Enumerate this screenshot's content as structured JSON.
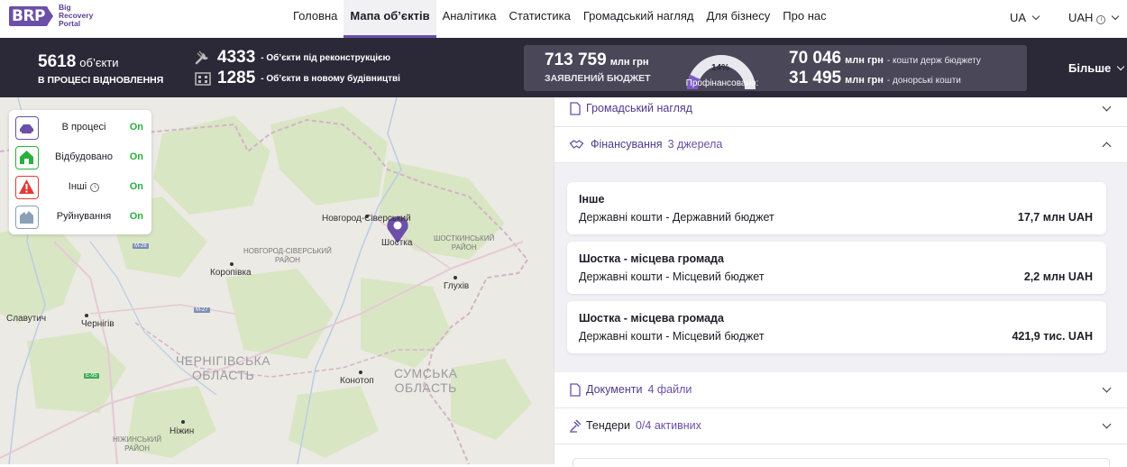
{
  "logo": {
    "mark": "BRP",
    "line1": "Big",
    "line2": "Recovery",
    "line3": "Portal"
  },
  "nav": {
    "links": [
      {
        "label": "Головна",
        "active": false
      },
      {
        "label": "Мапа об’єктів",
        "active": true
      },
      {
        "label": "Аналітика",
        "active": false
      },
      {
        "label": "Статистика",
        "active": false
      },
      {
        "label": "Громадський нагляд",
        "active": false
      },
      {
        "label": "Для бізнесу",
        "active": false
      },
      {
        "label": "Про нас",
        "active": false
      }
    ],
    "language": "UA",
    "currency": "UAH"
  },
  "stats": {
    "objects_count": "5618",
    "objects_unit": "об’єкти",
    "objects_sub": "В ПРОЦЕСІ ВІДНОВЛЕННЯ",
    "reconstruction_count": "4333",
    "reconstruction_desc": "- Об’єкти під реконструкцією",
    "new_build_count": "1285",
    "new_build_desc": "- Об’єкти в новому будівництві",
    "declared_budget": "713 759",
    "declared_unit": "млн грн",
    "declared_label": "ЗАЯВЛЕНИЙ БЮДЖЕТ",
    "financed_pct": "14%",
    "financed_fraction": 0.14,
    "financed_label": "Профінансовано:",
    "state_budget": "70 046",
    "state_unit": "млн грн",
    "state_desc": "- кошти держ бюджету",
    "donor": "31 495",
    "donor_unit": "млн грн",
    "donor_desc": "- донорські кошти",
    "more_label": "Більше"
  },
  "legend": [
    {
      "label": "В процесі",
      "state": "On",
      "color": "#6b4fa8",
      "icon": "construction-icon"
    },
    {
      "label": "Відбудовано",
      "state": "On",
      "color": "#27b13c",
      "icon": "house-icon"
    },
    {
      "label": "Інші",
      "state": "On",
      "color": "#e53935",
      "icon": "warning-icon"
    },
    {
      "label": "Руйнування",
      "state": "On",
      "color": "#8aa0b8",
      "icon": "ruin-icon"
    }
  ],
  "map": {
    "cities": [
      "Новгород-Сіверський",
      "Шостка",
      "Коропівка",
      "Глухів",
      "Славутич",
      "Чернігів",
      "Конотоп",
      "Ніжин"
    ],
    "regions": [
      "ЧЕРНІГІВСЬКА",
      "ОБЛАСТЬ",
      "СУМСЬКА",
      "ОБЛАСТЬ"
    ],
    "raions": [
      "НОВГОРОД-СІВЕРСЬКИЙ",
      "РАЙОН",
      "ШОСТКИНСЬКИЙ",
      "РАЙОН",
      "НІЖИНСЬКИЙ",
      "РАЙОН"
    ],
    "roads": [
      "M-28",
      "M-27",
      "E-95"
    ]
  },
  "panel": {
    "public_oversight": "Громадський нагляд",
    "financing_title": "Фінансування",
    "financing_count": "3 джерела",
    "sources": [
      {
        "name": "Інше",
        "type": "Державні кошти - Державний бюджет",
        "amount": "17,7 млн UAH"
      },
      {
        "name": "Шостка - місцева громада",
        "type": "Державні кошти - Місцевий бюджет",
        "amount": "2,2 млн UAH"
      },
      {
        "name": "Шостка - місцева громада",
        "type": "Державні кошти - Місцевий бюджет",
        "amount": "421,9 тис. UAH"
      }
    ],
    "documents_title": "Документи",
    "documents_count": "4 файли",
    "tenders_title": "Тендери",
    "tenders_count": "0/4 активних"
  }
}
